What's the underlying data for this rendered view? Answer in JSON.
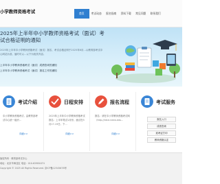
{
  "header": {
    "title": "小学教师资格考试",
    "nav": [
      "首页",
      "考试动态",
      "报名指南",
      "资料下载",
      "常见问题",
      "联系我们"
    ]
  },
  "hero": {
    "title": "2025年上半年中小学教师资格考试（面试）考试合格证明的通知",
    "summary": "2025年上半年中小学教师资格考试（面试）报名、考试合格证明于2025年6月...以教育部考试中心网站为准，届时可以...以下为相关内容。",
    "link1": "上半年中小学教师资格考试（面试）成绩查询的通知",
    "link2": "上半年中小学教师资格考试（面试）报名工作的通知"
  },
  "cards": {
    "intro": {
      "title": "考试介绍",
      "text": "中小学教师资格考试，由教育部考试中心统一组织...",
      "more": "详细>>"
    },
    "schedule": {
      "title": "日程安排",
      "text": "2025年上半年中小学教师资格考试报名：上半年笔试1月份，面试在5月17-19日，下...",
      "more": "详细>>"
    },
    "process": {
      "title": "报名流程",
      "text": "报名：请在中小学教师资格考试网（http://ntce.neea.edu...",
      "more": "详细>>"
    },
    "service": {
      "title": "考试服务",
      "buttons": [
        "报名入口",
        "成绩查询",
        "准考证打印",
        "教师资格认定"
      ]
    }
  },
  "footer": {
    "line1": "版权所有 · 教育部考试中心",
    "line2": "地址：北京市海淀区 电话：010-62984074",
    "line3": "Copyright © 2025 All Rights Reserved. 京ICP备12345678号"
  },
  "colors": {
    "accent": "#2f7fd0",
    "hero_bg": "#cfeaf7",
    "icon_red": "#e8513d",
    "icon_blue": "#3a86d6"
  }
}
